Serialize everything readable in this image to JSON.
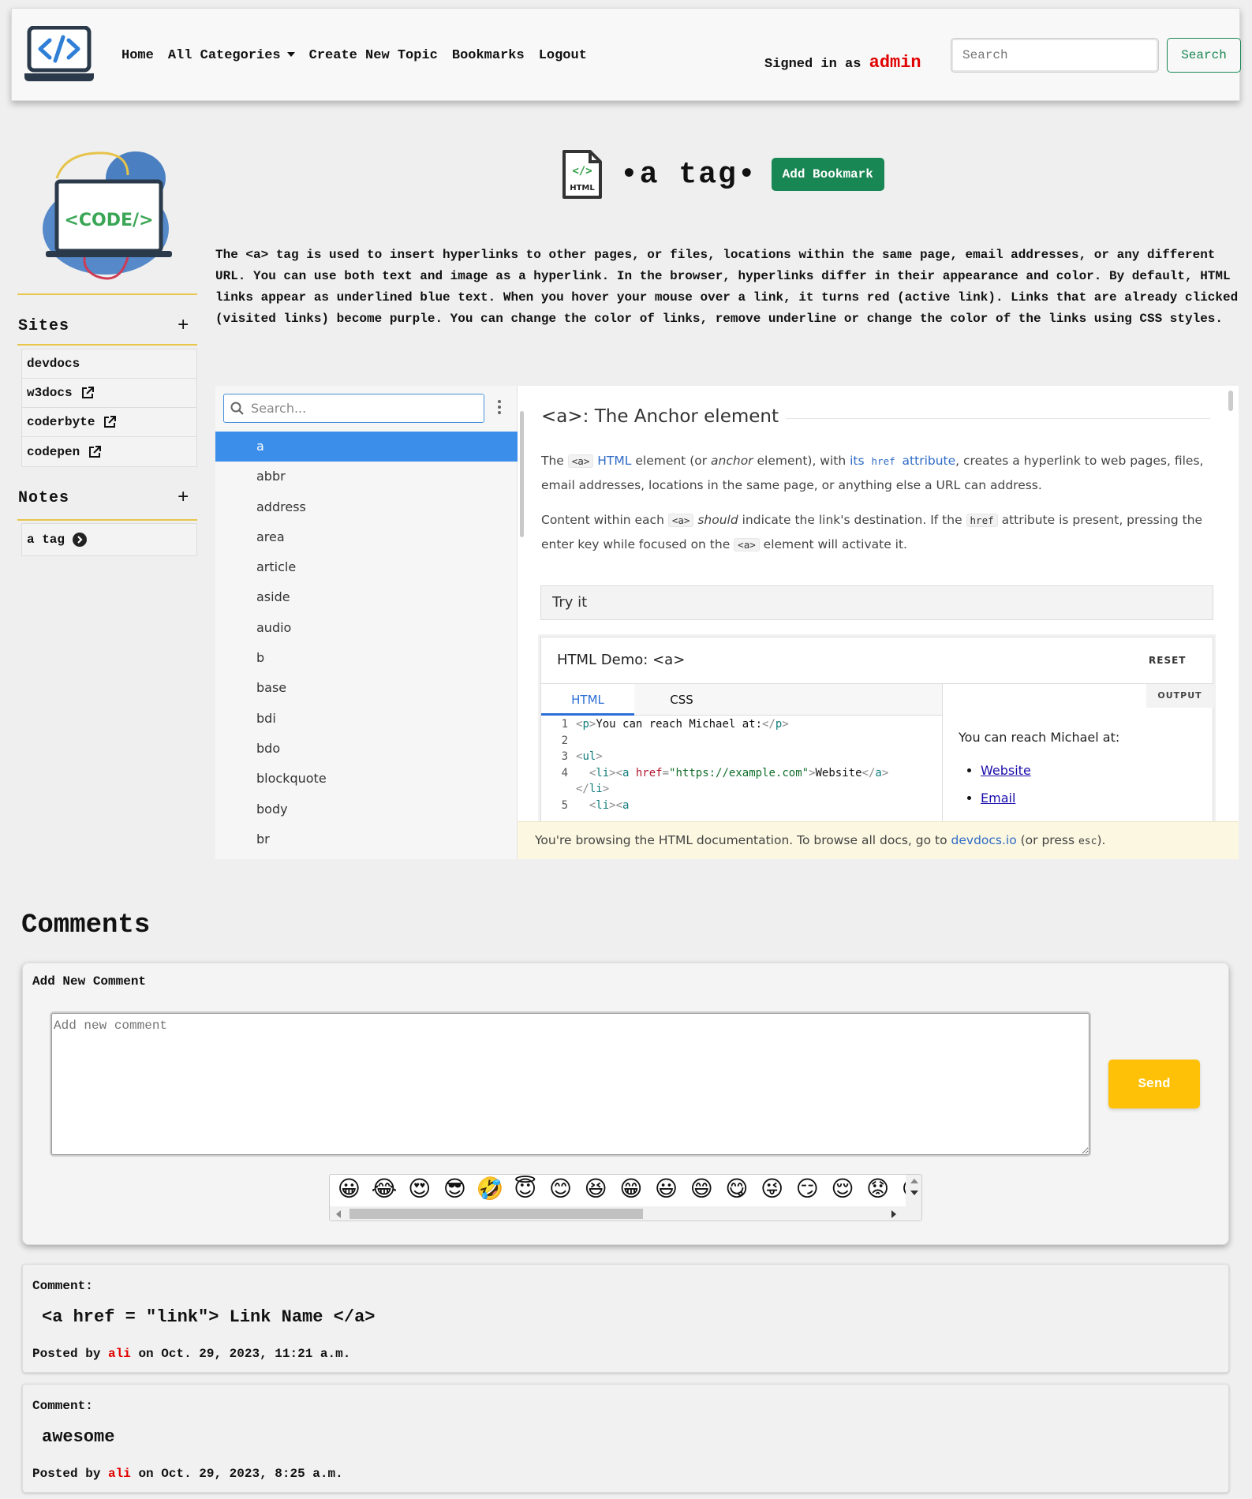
{
  "navbar": {
    "links": [
      "Home",
      "All Categories",
      "Create New Topic",
      "Bookmarks",
      "Logout"
    ],
    "signed_in_prefix": "Signed in as",
    "username": "admin",
    "search_placeholder": "Search",
    "search_button": "Search"
  },
  "sidebar": {
    "logo_text": "<CODE/>",
    "sites_title": "Sites",
    "sites": [
      "devdocs",
      "w3docs",
      "coderbyte",
      "codepen"
    ],
    "notes_title": "Notes",
    "notes": [
      "a tag"
    ]
  },
  "topic": {
    "icon_text": "HTML",
    "icon_code": "</>",
    "title": "•a tag•",
    "bookmark_button": "Add Bookmark",
    "description": "The <a> tag is used to insert hyperlinks to other pages, or files, locations within the same page, email addresses, or any different URL. You can use both text and image as a hyperlink. In the browser, hyperlinks differ in their appearance and color. By default, HTML links appear as underlined blue text. When you hover your mouse over a link, it turns red (active link). Links that are already clicked (visited links) become purple. You can change the color of links, remove underline or change the color of the links using CSS styles."
  },
  "devdocs": {
    "search_placeholder": "Search...",
    "items": [
      "a",
      "abbr",
      "address",
      "area",
      "article",
      "aside",
      "audio",
      "b",
      "base",
      "bdi",
      "bdo",
      "blockquote",
      "body",
      "br"
    ],
    "heading": "<a>: The Anchor element",
    "p1": {
      "t1": "The ",
      "c1": "<a>",
      "l1": "HTML",
      "t2": " element (or ",
      "em": "anchor",
      "t3": " element), with ",
      "l2": "its ",
      "l2code": "href",
      "l2b": " attribute",
      "t4": ", creates a hyperlink to web pages, files, email addresses, locations in the same page, or anything else a URL can address."
    },
    "p2": {
      "t1": "Content within each ",
      "c1": "<a>",
      "em": "should",
      "t2": " indicate the link's destination. If the ",
      "c2": "href",
      "t3": " attribute is present, pressing the enter key while focused on the ",
      "c3": "<a>",
      "t4": " element will activate it."
    },
    "try_it": "Try it",
    "demo_title": "HTML Demo: <a>",
    "reset": "RESET",
    "tabs": [
      "HTML",
      "CSS"
    ],
    "output_label": "OUTPUT",
    "code_lines": {
      "n1": "1",
      "n2": "2",
      "n3": "3",
      "n4": "4",
      "n5": "5",
      "l1a": "<",
      "l1b": "p",
      "l1c": ">",
      "l1d": "You can reach Michael at:",
      "l1e": "</",
      "l1f": "p",
      "l1g": ">",
      "l3a": "<",
      "l3b": "ul",
      "l3c": ">",
      "l4a": "<",
      "l4b": "li",
      "l4c": "><",
      "l4d": "a",
      "l4e": " href",
      "l4f": "=",
      "l4g": "\"https://example.com\"",
      "l4h": ">",
      "l4i": "Website",
      "l4j": "</",
      "l4k": "a",
      "l4l": ">",
      "l4m": "</",
      "l4n": "li",
      "l4o": ">",
      "l5a": "<",
      "l5b": "li",
      "l5c": "><",
      "l5d": "a"
    },
    "output_text": "You can reach Michael at:",
    "output_links": [
      "Website",
      "Email"
    ],
    "notice_t1": "You're browsing the HTML documentation. To browse all docs, go to ",
    "notice_link": "devdocs.io",
    "notice_t2": " (or press ",
    "notice_code": "esc",
    "notice_t3": ")."
  },
  "comments": {
    "heading": "Comments",
    "add_title": "Add New Comment",
    "placeholder": "Add new comment",
    "send": "Send",
    "emojis": [
      "😀",
      "😂",
      "😍",
      "😎",
      "🤣",
      "😇",
      "😊",
      "😆",
      "😁",
      "😃",
      "😄",
      "😋",
      "😜",
      "😏",
      "😌",
      "😟",
      "😕"
    ],
    "list": [
      {
        "label": "Comment:",
        "body": "<a href = \"link\"> Link Name </a>",
        "posted_by": "Posted by",
        "user": "ali",
        "on": "on Oct. 29, 2023, 11:21 a.m."
      },
      {
        "label": "Comment:",
        "body": "awesome",
        "posted_by": "Posted by",
        "user": "ali",
        "on": "on Oct. 29, 2023, 8:25 a.m."
      }
    ]
  }
}
